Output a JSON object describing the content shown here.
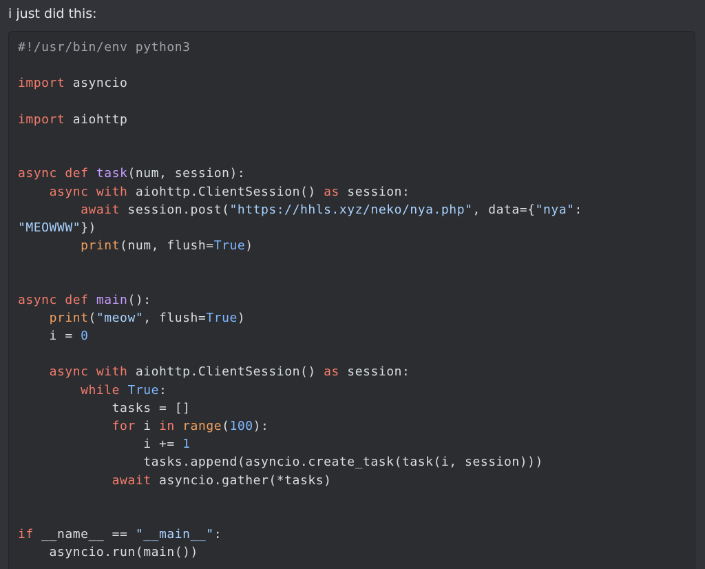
{
  "message": {
    "text": "i just did this:"
  },
  "code_block": {
    "language": "python",
    "lines": [
      [
        {
          "t": "#!/usr/bin/env python3",
          "c": "comment"
        }
      ],
      [],
      [
        {
          "t": "import",
          "c": "kw"
        },
        {
          "t": " asyncio",
          "c": ""
        }
      ],
      [],
      [
        {
          "t": "import",
          "c": "kw"
        },
        {
          "t": " aiohttp",
          "c": ""
        }
      ],
      [],
      [],
      [
        {
          "t": "async",
          "c": "kw"
        },
        {
          "t": " ",
          "c": ""
        },
        {
          "t": "def",
          "c": "kw"
        },
        {
          "t": " ",
          "c": ""
        },
        {
          "t": "task",
          "c": "fn"
        },
        {
          "t": "(num, session):",
          "c": ""
        }
      ],
      [
        {
          "t": "    ",
          "c": ""
        },
        {
          "t": "async",
          "c": "kw"
        },
        {
          "t": " ",
          "c": ""
        },
        {
          "t": "with",
          "c": "kw"
        },
        {
          "t": " aiohttp.ClientSession() ",
          "c": ""
        },
        {
          "t": "as",
          "c": "kw"
        },
        {
          "t": " session:",
          "c": ""
        }
      ],
      [
        {
          "t": "        ",
          "c": ""
        },
        {
          "t": "await",
          "c": "kw"
        },
        {
          "t": " session.post(",
          "c": ""
        },
        {
          "t": "\"https://hhls.xyz/neko/nya.php\"",
          "c": "str"
        },
        {
          "t": ", data={",
          "c": ""
        },
        {
          "t": "\"nya\"",
          "c": "str"
        },
        {
          "t": ":",
          "c": ""
        }
      ],
      [
        {
          "t": "\"MEOWWW\"",
          "c": "str"
        },
        {
          "t": "})",
          "c": ""
        }
      ],
      [
        {
          "t": "        ",
          "c": ""
        },
        {
          "t": "print",
          "c": "builtin"
        },
        {
          "t": "(num, flush=",
          "c": ""
        },
        {
          "t": "True",
          "c": "const"
        },
        {
          "t": ")",
          "c": ""
        }
      ],
      [],
      [],
      [
        {
          "t": "async",
          "c": "kw"
        },
        {
          "t": " ",
          "c": ""
        },
        {
          "t": "def",
          "c": "kw"
        },
        {
          "t": " ",
          "c": ""
        },
        {
          "t": "main",
          "c": "fn"
        },
        {
          "t": "():",
          "c": ""
        }
      ],
      [
        {
          "t": "    ",
          "c": ""
        },
        {
          "t": "print",
          "c": "builtin"
        },
        {
          "t": "(",
          "c": ""
        },
        {
          "t": "\"meow\"",
          "c": "str"
        },
        {
          "t": ", flush=",
          "c": ""
        },
        {
          "t": "True",
          "c": "const"
        },
        {
          "t": ")",
          "c": ""
        }
      ],
      [
        {
          "t": "    i = ",
          "c": ""
        },
        {
          "t": "0",
          "c": "num"
        }
      ],
      [],
      [
        {
          "t": "    ",
          "c": ""
        },
        {
          "t": "async",
          "c": "kw"
        },
        {
          "t": " ",
          "c": ""
        },
        {
          "t": "with",
          "c": "kw"
        },
        {
          "t": " aiohttp.ClientSession() ",
          "c": ""
        },
        {
          "t": "as",
          "c": "kw"
        },
        {
          "t": " session:",
          "c": ""
        }
      ],
      [
        {
          "t": "        ",
          "c": ""
        },
        {
          "t": "while",
          "c": "kw"
        },
        {
          "t": " ",
          "c": ""
        },
        {
          "t": "True",
          "c": "const"
        },
        {
          "t": ":",
          "c": ""
        }
      ],
      [
        {
          "t": "            tasks = []",
          "c": ""
        }
      ],
      [
        {
          "t": "            ",
          "c": ""
        },
        {
          "t": "for",
          "c": "kw"
        },
        {
          "t": " i ",
          "c": ""
        },
        {
          "t": "in",
          "c": "kw"
        },
        {
          "t": " ",
          "c": ""
        },
        {
          "t": "range",
          "c": "builtin"
        },
        {
          "t": "(",
          "c": ""
        },
        {
          "t": "100",
          "c": "num"
        },
        {
          "t": "):",
          "c": ""
        }
      ],
      [
        {
          "t": "                i += ",
          "c": ""
        },
        {
          "t": "1",
          "c": "num"
        }
      ],
      [
        {
          "t": "                tasks.append(asyncio.create_task(task(i, session)))",
          "c": ""
        }
      ],
      [
        {
          "t": "            ",
          "c": ""
        },
        {
          "t": "await",
          "c": "kw"
        },
        {
          "t": " asyncio.gather(*tasks)",
          "c": ""
        }
      ],
      [],
      [],
      [
        {
          "t": "if",
          "c": "kw"
        },
        {
          "t": " __name__ == ",
          "c": ""
        },
        {
          "t": "\"__main__\"",
          "c": "str"
        },
        {
          "t": ":",
          "c": ""
        }
      ],
      [
        {
          "t": "    asyncio.run(main())",
          "c": ""
        }
      ]
    ]
  },
  "colors": {
    "background": "#313338",
    "code_background": "#2b2d31",
    "keyword": "#f57c6b",
    "function": "#c89bff",
    "builtin": "#f2a15e",
    "string": "#a9d2ff",
    "number": "#7fb8ff",
    "comment": "#a0a3a8",
    "text": "#dbdee1"
  }
}
